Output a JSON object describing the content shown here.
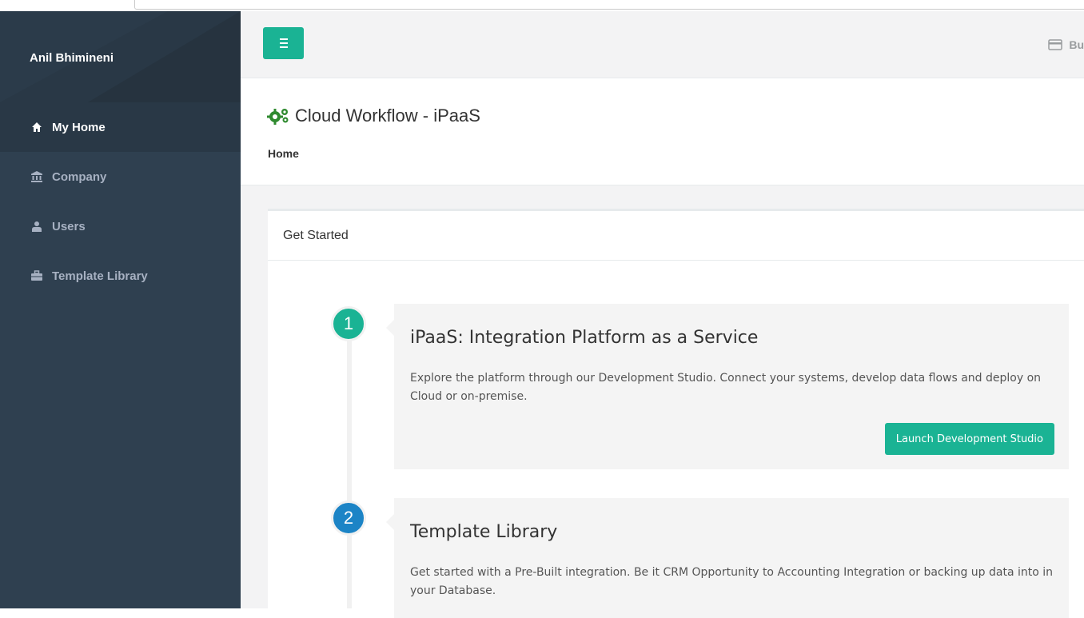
{
  "user": {
    "name": "Anil Bhimineni"
  },
  "sidebar": {
    "items": [
      {
        "label": "My Home",
        "icon": "home-icon",
        "active": true
      },
      {
        "label": "Company",
        "icon": "bank-icon",
        "active": false
      },
      {
        "label": "Users",
        "icon": "user-icon",
        "active": false
      },
      {
        "label": "Template Library",
        "icon": "briefcase-icon",
        "active": false
      }
    ]
  },
  "topbar": {
    "menu_icon": "hamburger-icon",
    "billing_label": "Bu",
    "billing_icon": "credit-card-icon"
  },
  "heading": {
    "title": "Cloud Workflow - iPaaS",
    "title_icon": "gears-icon",
    "breadcrumb": "Home"
  },
  "card": {
    "header": "Get Started"
  },
  "steps": [
    {
      "number": "1",
      "title": "iPaaS: Integration Platform as a Service",
      "description": "Explore the platform through our Development Studio. Connect your systems, develop data flows and deploy on Cloud or on-premise.",
      "button_label": "Launch Development Studio"
    },
    {
      "number": "2",
      "title": "Template Library",
      "description": "Get started with a Pre-Built integration. Be it CRM Opportunity to Accounting Integration or backing up data into in your Database."
    }
  ],
  "colors": {
    "sidebar_bg": "#2f4050",
    "accent_green": "#1ab394",
    "accent_blue": "#1c84c6",
    "sidebar_text": "#a7b1c2"
  }
}
